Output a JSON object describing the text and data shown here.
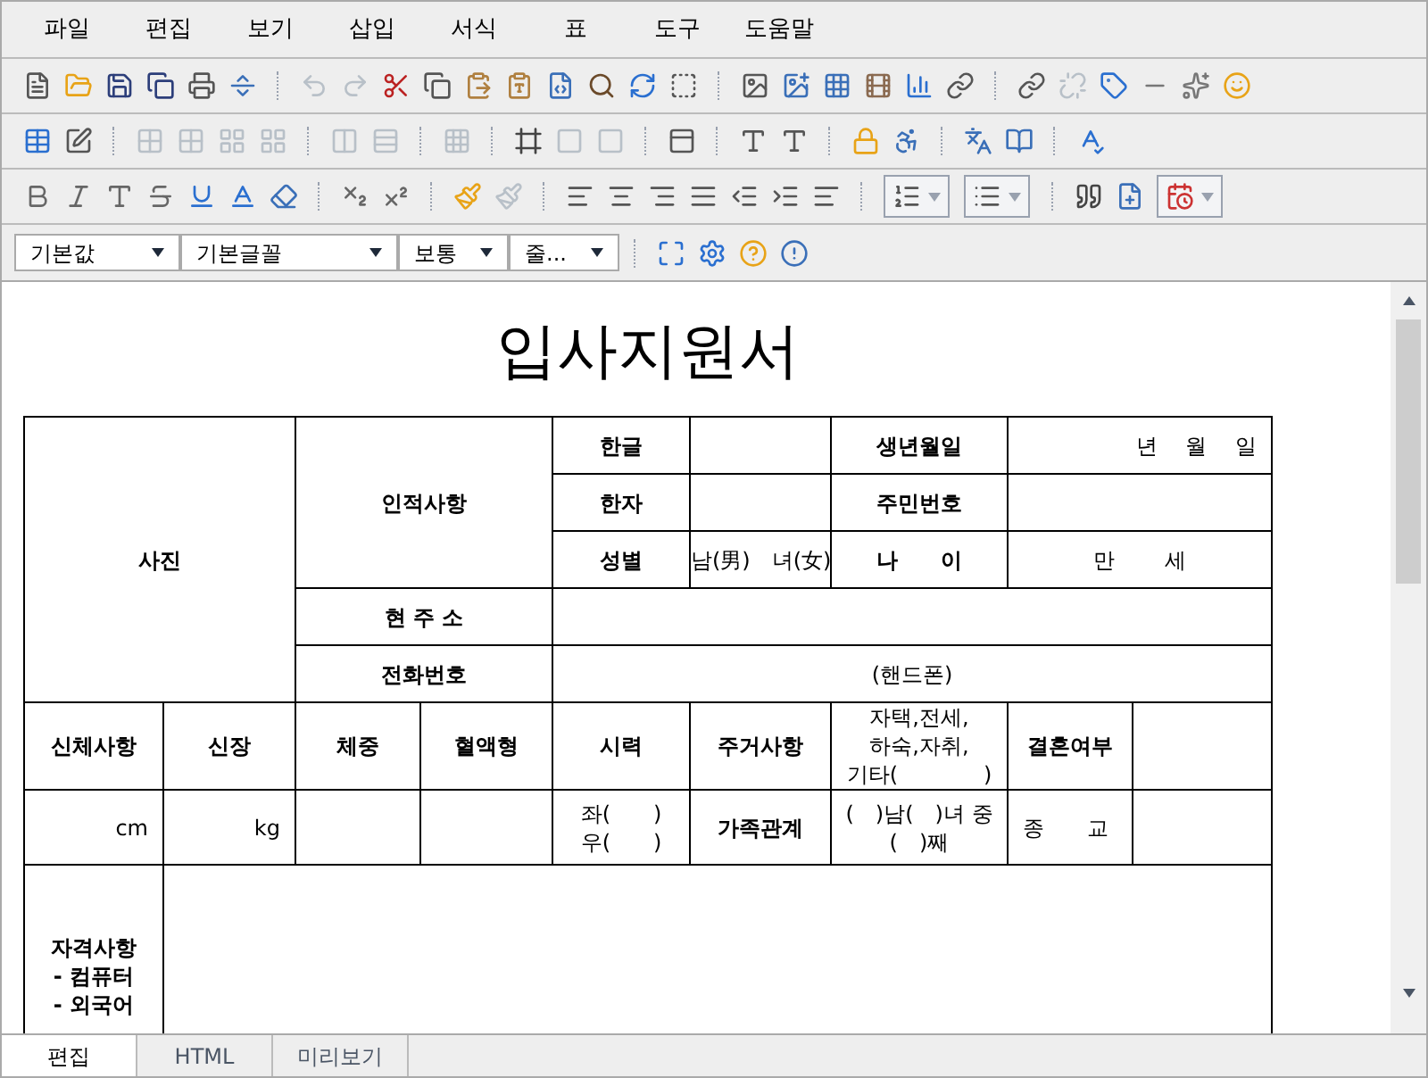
{
  "menu": [
    {
      "label": "파일"
    },
    {
      "label": "편집"
    },
    {
      "label": "보기"
    },
    {
      "label": "삽입"
    },
    {
      "label": "서식"
    },
    {
      "label": "표"
    },
    {
      "label": "도구"
    },
    {
      "label": "도움말"
    }
  ],
  "toolbars": [
    [
      [
        {
          "disabled": false
        },
        {
          "disabled": false
        },
        {
          "disabled": false
        },
        {
          "disabled": false
        },
        {
          "disabled": false
        },
        {
          "disabled": false
        }
      ],
      [
        {
          "disabled": true
        },
        {
          "disabled": true
        },
        {
          "disabled": false
        },
        {
          "disabled": false
        },
        {
          "disabled": false
        },
        {
          "disabled": false
        },
        {
          "disabled": false
        },
        {
          "disabled": false
        },
        {
          "disabled": false
        },
        {
          "disabled": false
        }
      ],
      [
        {
          "disabled": false
        },
        {
          "disabled": false
        },
        {
          "disabled": false
        },
        {
          "disabled": false
        },
        {
          "disabled": false
        },
        {
          "disabled": false
        }
      ],
      [
        {
          "disabled": false
        },
        {
          "disabled": true
        },
        {
          "disabled": false
        },
        {
          "disabled": false
        },
        {
          "disabled": false
        },
        {
          "disabled": false
        }
      ]
    ],
    [
      [
        {
          "disabled": false
        },
        {
          "disabled": false
        }
      ],
      [
        {
          "disabled": true
        },
        {
          "disabled": true
        },
        {
          "disabled": true
        },
        {
          "disabled": true
        }
      ],
      [
        {
          "disabled": true
        },
        {
          "disabled": true
        }
      ],
      [
        {
          "disabled": true
        }
      ],
      [
        {
          "disabled": false
        },
        {
          "disabled": true
        },
        {
          "disabled": true
        }
      ],
      [
        {
          "disabled": false
        }
      ],
      [
        {
          "disabled": false
        },
        {
          "disabled": false
        }
      ],
      [
        {
          "disabled": false
        },
        {
          "disabled": false
        }
      ],
      [
        {
          "disabled": false
        },
        {
          "disabled": false
        }
      ],
      [
        {
          "disabled": false
        }
      ]
    ],
    [
      [
        {
          "disabled": false
        },
        {
          "disabled": false
        },
        {
          "disabled": false
        },
        {
          "disabled": false
        },
        {
          "disabled": false
        },
        {
          "disabled": false
        },
        {
          "disabled": false
        }
      ],
      [
        {
          "disabled": false
        },
        {
          "disabled": false
        }
      ],
      [
        {
          "disabled": false
        },
        {
          "disabled": true
        }
      ],
      [
        {
          "disabled": false
        },
        {
          "disabled": false
        },
        {
          "disabled": false
        },
        {
          "disabled": false
        },
        {
          "disabled": false
        },
        {
          "disabled": false
        },
        {
          "disabled": false
        }
      ],
      [
        {
          "disabled": false,
          "kind": "split"
        },
        {
          "disabled": false,
          "kind": "split"
        }
      ],
      [
        {
          "disabled": false
        },
        {
          "disabled": false
        },
        {
          "disabled": false,
          "kind": "split"
        }
      ]
    ]
  ],
  "format_selects": [
    {
      "value": "기본값"
    },
    {
      "value": "기본글꼴"
    },
    {
      "value": "보통"
    },
    {
      "value": "줄..."
    }
  ],
  "format_tools": [
    {
      "disabled": false
    },
    {
      "disabled": false
    },
    {
      "disabled": false
    },
    {
      "disabled": false
    }
  ],
  "document": {
    "title": "입사지원서",
    "rows": [
      [
        {
          "lines": [
            "사진"
          ],
          "kind": "label",
          "colspan": 2,
          "rowspan": 5
        },
        {
          "lines": [
            "인적사항"
          ],
          "kind": "label",
          "colspan": 2,
          "rowspan": 3
        },
        {
          "lines": [
            "한글"
          ],
          "kind": "label"
        },
        {
          "kind": "value"
        },
        {
          "lines": [
            "생년월일"
          ],
          "kind": "label"
        },
        {
          "lines": [
            "년　 월　 일"
          ],
          "kind": "value_right",
          "colspan": 2
        }
      ],
      [
        {
          "lines": [
            "한자"
          ],
          "kind": "label"
        },
        {
          "kind": "value"
        },
        {
          "lines": [
            "주민번호"
          ],
          "kind": "label"
        },
        {
          "kind": "value",
          "colspan": 2
        }
      ],
      [
        {
          "lines": [
            "성별"
          ],
          "kind": "label"
        },
        {
          "lines": [
            "남(男)　녀(女)"
          ],
          "kind": "value"
        },
        {
          "lines": [
            "나　　이"
          ],
          "kind": "label"
        },
        {
          "lines": [
            "만　　 세"
          ],
          "kind": "value",
          "colspan": 2
        }
      ],
      [
        {
          "lines": [
            "현 주 소"
          ],
          "kind": "label",
          "colspan": 2
        },
        {
          "kind": "value",
          "colspan": 5
        }
      ],
      [
        {
          "lines": [
            "전화번호"
          ],
          "kind": "label",
          "colspan": 2
        },
        {
          "lines": [
            "(핸드폰)"
          ],
          "kind": "value",
          "colspan": 5
        }
      ],
      [
        {
          "lines": [
            "신체사항"
          ],
          "kind": "label"
        },
        {
          "lines": [
            "신장"
          ],
          "kind": "label"
        },
        {
          "lines": [
            "체중"
          ],
          "kind": "label"
        },
        {
          "lines": [
            "혈액형"
          ],
          "kind": "label"
        },
        {
          "lines": [
            "시력"
          ],
          "kind": "label"
        },
        {
          "lines": [
            "주거사항"
          ],
          "kind": "label"
        },
        {
          "lines": [
            "자택,전세,",
            "하숙,자취,",
            "기타(　　　　)"
          ],
          "kind": "value"
        },
        {
          "lines": [
            "결혼여부"
          ],
          "kind": "label"
        },
        {
          "kind": "value"
        }
      ],
      [
        {
          "lines": [
            "cm"
          ],
          "kind": "value_right"
        },
        {
          "lines": [
            "kg"
          ],
          "kind": "value_right"
        },
        {
          "kind": "value"
        },
        {
          "kind": "value"
        },
        {
          "lines": [
            "좌(　　)",
            "우(　　)"
          ],
          "kind": "value"
        },
        {
          "lines": [
            "가족관계"
          ],
          "kind": "label"
        },
        {
          "lines": [
            "(　)남(　)녀 중",
            "(　)째"
          ],
          "kind": "value"
        },
        {
          "lines": [
            "종　　교"
          ],
          "kind": "value_left"
        },
        {
          "kind": "value"
        }
      ],
      [
        {
          "lines": [
            "자격사항",
            "- 컴퓨터",
            "- 외국어"
          ],
          "kind": "label"
        },
        {
          "kind": "value",
          "colspan": 8
        }
      ]
    ]
  },
  "tabs": [
    {
      "label": "편집",
      "selected": true
    },
    {
      "label": "HTML",
      "selected": false
    },
    {
      "label": "미리보기",
      "selected": false
    }
  ]
}
